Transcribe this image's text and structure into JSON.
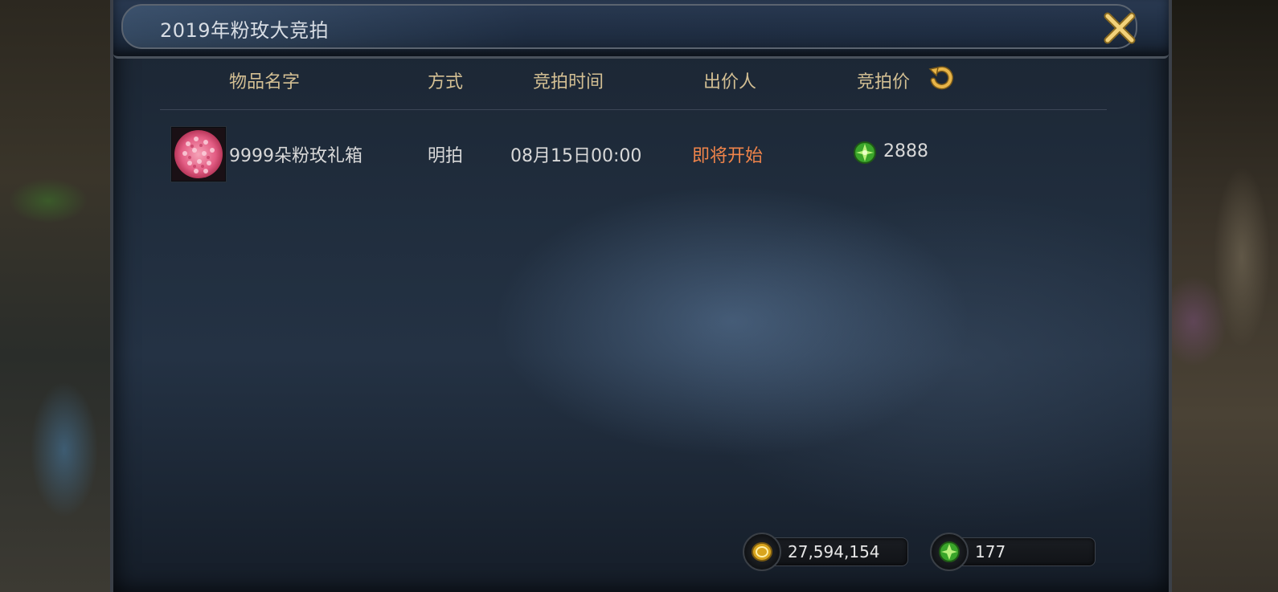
{
  "window": {
    "title": "2019年粉玫大竞拍"
  },
  "table": {
    "headers": {
      "name": "物品名字",
      "mode": "方式",
      "time": "竞拍时间",
      "bidder": "出价人",
      "price": "竞拍价"
    },
    "rows": [
      {
        "name": "9999朵粉玫礼箱",
        "mode": "明拍",
        "time": "08月15日00:00",
        "bidder": "即将开始",
        "price": "2888",
        "icon": "pink-rose-bouquet-icon"
      }
    ]
  },
  "wallet": {
    "gold": "27,594,154",
    "gems": "177"
  },
  "colors": {
    "header_text": "#d3bf93",
    "status_orange": "#f0844a",
    "panel_bg": "#1e2b3b"
  }
}
